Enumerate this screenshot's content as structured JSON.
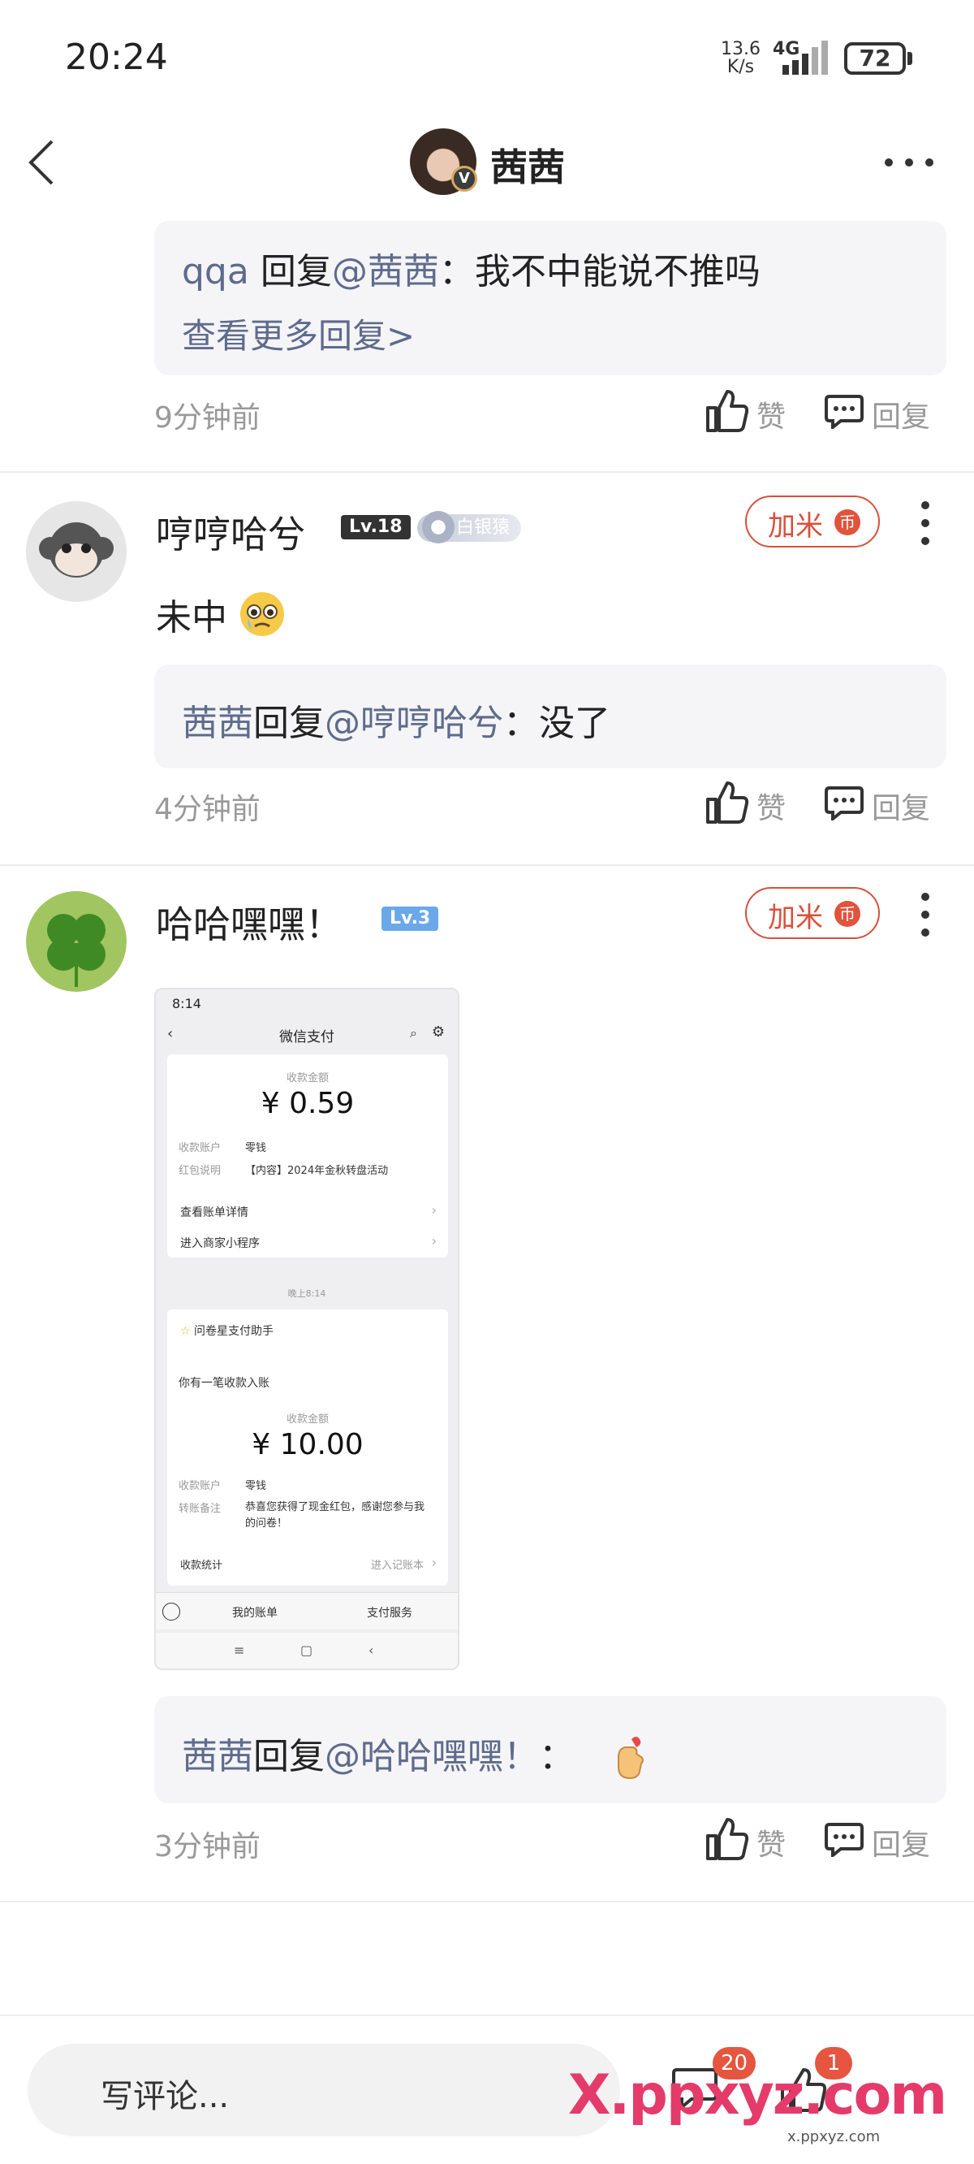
{
  "status_bar": {
    "time": "20:24",
    "net_speed_value": "13.6",
    "net_speed_unit": "K/s",
    "network": "4G",
    "battery": "72"
  },
  "nav": {
    "title": "茜茜"
  },
  "thread_top": {
    "reply_from": "qqa",
    "reply_word": " 回复",
    "reply_to": "@茜茜",
    "reply_text": "：我不中能说不推吗",
    "more_replies": "查看更多回复>",
    "time": "9分钟前"
  },
  "actions": {
    "like_label": "赞",
    "reply_label": "回复"
  },
  "comments": [
    {
      "username": "哼哼哈兮",
      "level": "Lv.18",
      "rank": "白银猿",
      "jiami_label": "加米",
      "jiami_coin": "币",
      "text": "未中",
      "reply": {
        "from": "茜茜",
        "word": "回复",
        "to": "@哼哼哈兮",
        "text": "：没了"
      },
      "time": "4分钟前"
    },
    {
      "username": "哈哈嘿嘿！",
      "level": "Lv.3",
      "jiami_label": "加米",
      "jiami_coin": "币",
      "reply": {
        "from": "茜茜",
        "word": "回复",
        "to": "@哈哈嘿嘿！",
        "text": "："
      },
      "time": "3分钟前"
    }
  ],
  "embedded_screenshot": {
    "time": "8:14",
    "title": "微信支付",
    "amount_label_1": "收款金额",
    "amount_1": "¥ 0.59",
    "account_label": "收款账户",
    "account_value": "零钱",
    "note_label_1": "红包说明",
    "note_value_1": "【内容】2024年金秋转盘活动",
    "link_1": "查看账单详情",
    "link_2": "进入商家小程序",
    "divider_time": "晚上8:14",
    "assistant": "问卷星支付助手",
    "notice": "你有一笔收款入账",
    "amount_label_2": "收款金额",
    "amount_2": "¥ 10.00",
    "account_label_2": "收款账户",
    "account_value_2": "零钱",
    "note_label_2": "转账备注",
    "note_value_2": "恭喜您获得了现金红包，感谢您参与我的问卷！",
    "stats_label": "收款统计",
    "stats_link": "进入记账本",
    "tab_1": "我的账单",
    "tab_2": "支付服务"
  },
  "bottom_bar": {
    "input_placeholder": "写评论...",
    "comment_count": "20",
    "like_count": "1"
  },
  "watermark": {
    "text": "X.ppxyz.com",
    "small": "x.ppxyz.com"
  },
  "colors": {
    "link_blue": "#5e6b8c",
    "accent_red": "#d8503b",
    "gray_text": "#999999",
    "reply_bg": "#f5f5f7"
  }
}
